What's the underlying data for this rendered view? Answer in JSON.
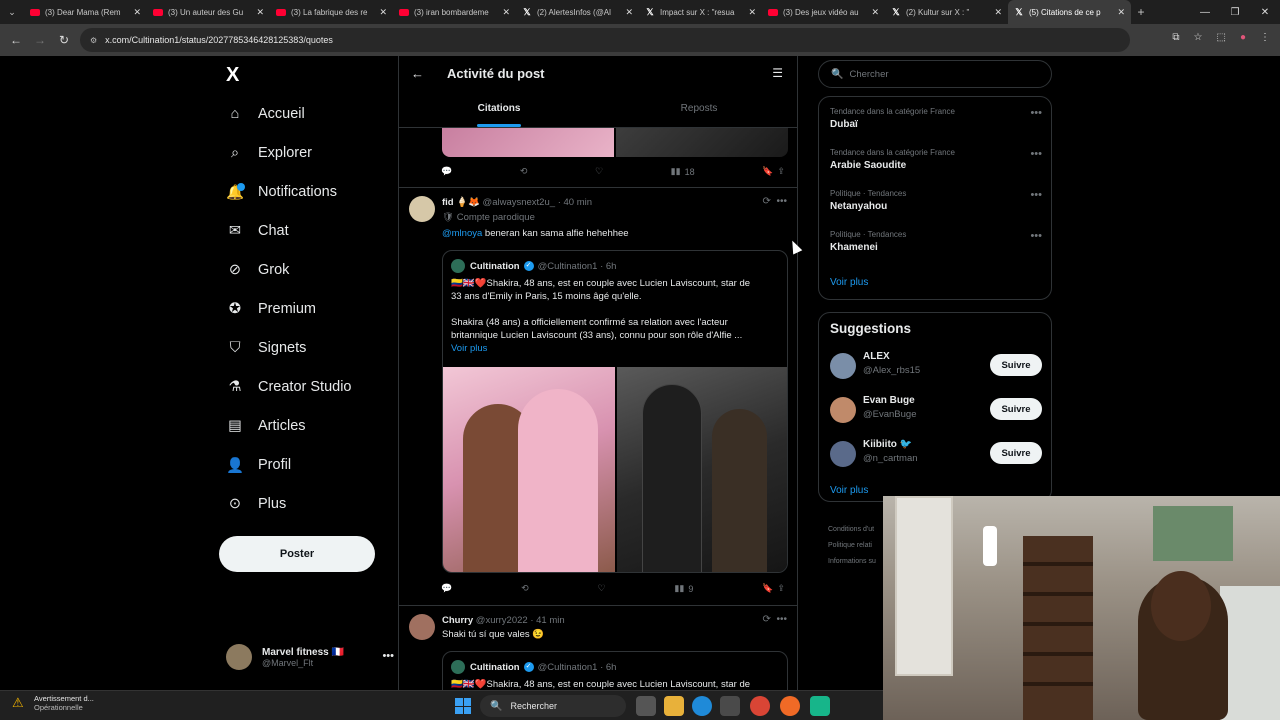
{
  "browser": {
    "tabs": [
      {
        "title": "(3) Dear Mama (Rem",
        "type": "youtube"
      },
      {
        "title": "(3) Un auteur des Gu",
        "type": "youtube"
      },
      {
        "title": "(3) La fabrique des re",
        "type": "youtube"
      },
      {
        "title": "(3) iran bombardeme",
        "type": "youtube"
      },
      {
        "title": "(2) AlertesInfos (@Al",
        "type": "x"
      },
      {
        "title": "Impact sur X : \"resua",
        "type": "x"
      },
      {
        "title": "(3) Des jeux vidéo au",
        "type": "youtube"
      },
      {
        "title": "(2) Kultur sur X : \"",
        "type": "x"
      },
      {
        "title": "(5) Citations de ce p",
        "type": "x",
        "active": true
      }
    ],
    "url": "x.com/Cultination1/status/2027785346428125383/quotes"
  },
  "nav": {
    "logo": "X",
    "items": [
      {
        "label": "Accueil",
        "icon": "home-icon"
      },
      {
        "label": "Explorer",
        "icon": "search-icon"
      },
      {
        "label": "Notifications",
        "icon": "bell-icon"
      },
      {
        "label": "Chat",
        "icon": "mail-icon"
      },
      {
        "label": "Grok",
        "icon": "grok-icon"
      },
      {
        "label": "Premium",
        "icon": "premium-icon"
      },
      {
        "label": "Signets",
        "icon": "bookmark-icon"
      },
      {
        "label": "Creator Studio",
        "icon": "flask-icon"
      },
      {
        "label": "Articles",
        "icon": "article-icon"
      },
      {
        "label": "Profil",
        "icon": "person-icon"
      },
      {
        "label": "Plus",
        "icon": "more-circle-icon"
      }
    ],
    "post_button": "Poster",
    "account": {
      "name": "Marvel fitness 🇫🇷",
      "handle": "@Marvel_Flt"
    }
  },
  "center": {
    "title": "Activité du post",
    "tabs": [
      "Citations",
      "Reposts"
    ],
    "prev_views": "18",
    "tweet1": {
      "name": "fid 🍦🦊",
      "handle": "@alwaysnext2u_",
      "time": "· 40 min",
      "sub": "Compte parodique",
      "mention": "@mlnoya",
      "text": " beneran kan sama alfie hehehhee",
      "views": "9"
    },
    "quote": {
      "name": "Cultination",
      "handle": "@Cultination1",
      "time": "· 6h",
      "line1": "🇨🇴🇬🇧❤️Shakira, 48 ans, est en couple avec Lucien Laviscount, star de",
      "line2": "33 ans d'Emily in Paris, 15 moins âgé qu'elle.",
      "line3": "Shakira (48 ans) a officiellement confirmé sa relation avec l'acteur",
      "line4": "britannique Lucien Laviscount (33 ans), connu pour son rôle d'Alfie ...",
      "more": "Voir plus"
    },
    "tweet2": {
      "name": "Churry",
      "handle": "@xurry2022",
      "time": "· 41 min",
      "text": "Shaki tú sí que vales 😉"
    },
    "quote2": {
      "name": "Cultination",
      "handle": "@Cultination1",
      "time": "· 6h",
      "line1": "🇨🇴🇬🇧❤️Shakira, 48 ans, est en couple avec Lucien Laviscount, star de"
    }
  },
  "right": {
    "search_placeholder": "Chercher",
    "trends": [
      {
        "category": "Tendance dans la catégorie France",
        "name": "Dubaï"
      },
      {
        "category": "Tendance dans la catégorie France",
        "name": "Arabie Saoudite"
      },
      {
        "category": "Politique · Tendances",
        "name": "Netanyahou"
      },
      {
        "category": "Politique · Tendances",
        "name": "Khamenei"
      }
    ],
    "see_more": "Voir plus",
    "suggestions_title": "Suggestions",
    "suggestions": [
      {
        "name": "ALEX",
        "handle": "@Alex_rbs15",
        "button": "Suivre"
      },
      {
        "name": "Evan Buge",
        "handle": "@EvanBuge",
        "button": "Suivre"
      },
      {
        "name": "Kiibiito 🐦",
        "handle": "@n_cartman",
        "button": "Suivre"
      }
    ],
    "footer1": "Conditions d'ut",
    "footer2": "Politique relati",
    "footer3": "Informations su"
  },
  "taskbar": {
    "warning_title": "Avertissement d...",
    "warning_sub": "Opérationnelle",
    "search": "Rechercher"
  }
}
